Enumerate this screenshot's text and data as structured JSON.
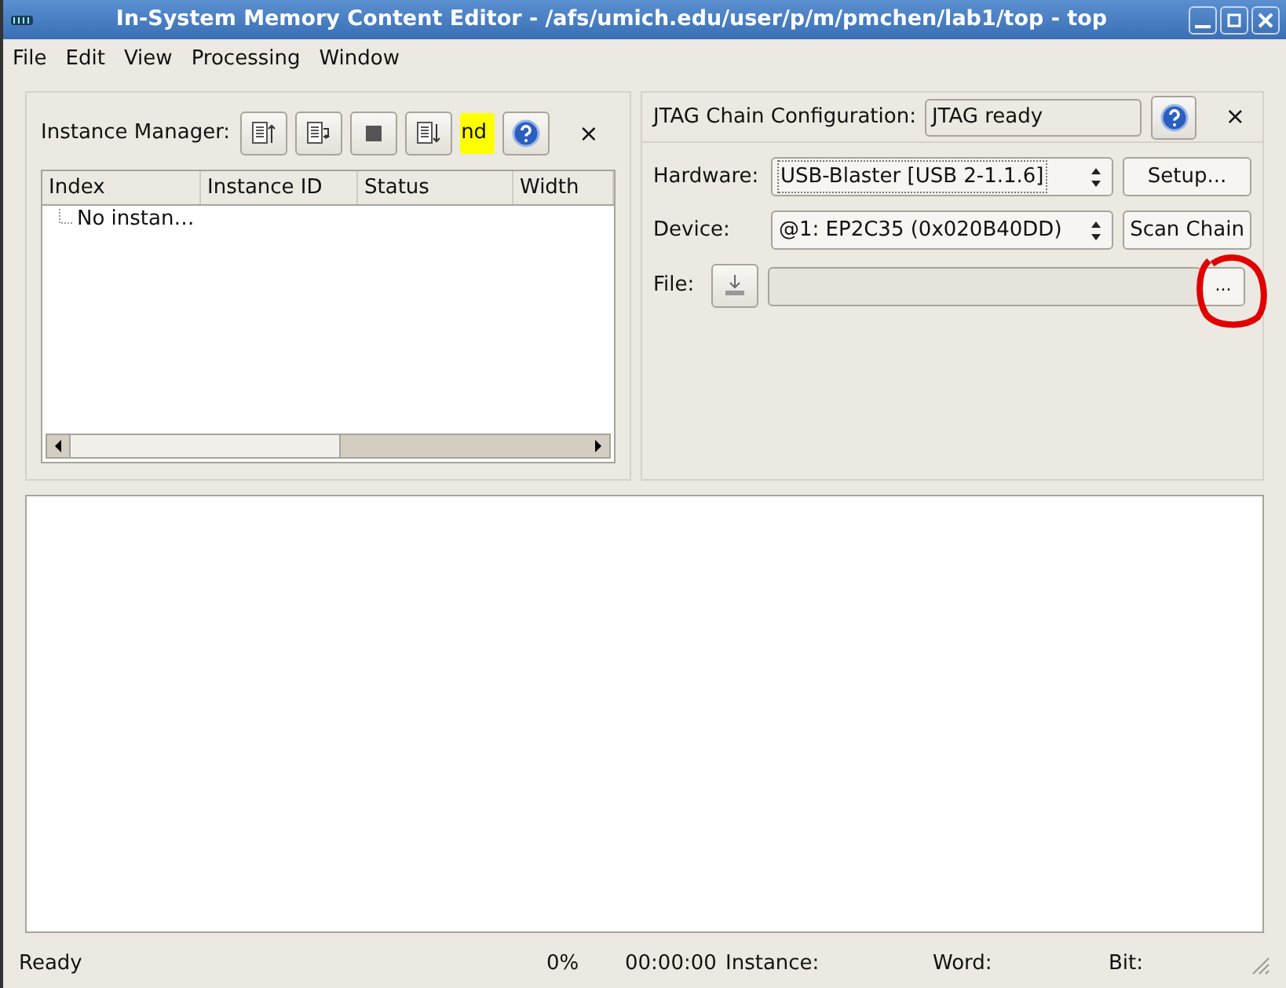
{
  "window": {
    "title": "In-System Memory Content Editor - /afs/umich.edu/user/p/m/pmchen/lab1/top - top"
  },
  "menu": [
    "File",
    "Edit",
    "View",
    "Processing",
    "Window"
  ],
  "instance_manager": {
    "label": "Instance Manager:",
    "highlight_text": "nd",
    "close": "×",
    "columns": [
      "Index",
      "Instance ID",
      "Status",
      "Width"
    ],
    "rows": [
      {
        "label": "No instan…"
      }
    ]
  },
  "jtag": {
    "label": "JTAG Chain Configuration:",
    "status": "JTAG ready",
    "close": "×",
    "hardware_label": "Hardware:",
    "hardware": "USB-Blaster [USB 2-1.1.6]",
    "setup": "Setup...",
    "device_label": "Device:",
    "device": "@1: EP2C35 (0x020B40DD)",
    "scan": "Scan Chain",
    "file_label": "File:",
    "browse": "..."
  },
  "status_bar": {
    "message": "Ready",
    "progress": "0%",
    "time": "00:00:00",
    "instance": "Instance:",
    "word": "Word:",
    "bit": "Bit:"
  }
}
